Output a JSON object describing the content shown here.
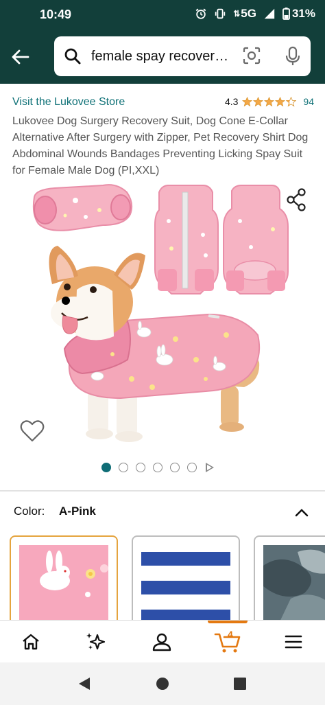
{
  "status_bar": {
    "time": "10:49",
    "network": "5G",
    "battery": "31%",
    "icons": [
      "alarm-icon",
      "vibrate-icon",
      "signal-icon",
      "battery-icon"
    ]
  },
  "search": {
    "query": "female spay recovery suit for dogs",
    "icons": [
      "back-arrow-icon",
      "search-icon",
      "camera-lens-icon",
      "mic-icon"
    ]
  },
  "product": {
    "store_link": "Visit the Lukovee Store",
    "rating": "4.3",
    "rating_value": 4.3,
    "rating_count": "94",
    "title": "Lukovee Dog Surgery Recovery Suit, Dog Cone E-Collar Alternative After Surgery with Zipper, Pet Recovery Shirt Dog Abdominal Wounds Bandages Preventing Licking Spay Suit for Female Male Dog (PI,XXL)"
  },
  "gallery": {
    "image_count": 6,
    "active_index": 0,
    "colors": {
      "suit_pink": "#f4a7b9",
      "collar_pink": "#ec8aa6",
      "dot_active": "#0f6d76"
    }
  },
  "color_selector": {
    "label": "Color:",
    "value": "A-Pink",
    "swatches": [
      {
        "name": "A-Pink",
        "selected": true
      },
      {
        "name": "Blue stripe",
        "selected": false
      },
      {
        "name": "Camo",
        "selected": false
      }
    ]
  },
  "bottom_nav": {
    "items": [
      "home-icon",
      "ai-sparkle-icon",
      "account-icon",
      "cart-icon",
      "menu-icon"
    ],
    "cart_count": "4"
  },
  "theme": {
    "header_bg": "#123f3a",
    "link_color": "#0f7177",
    "star_color": "#f3a847",
    "cart_orange": "#e47911"
  }
}
